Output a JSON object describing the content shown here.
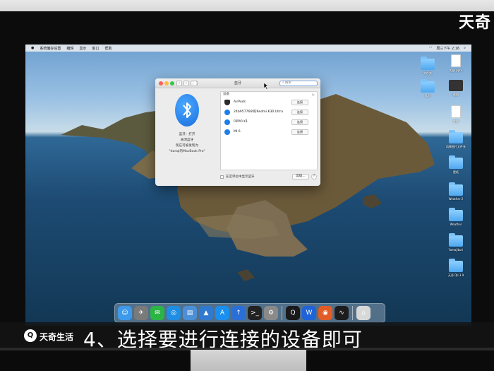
{
  "watermark": {
    "brand_top": "天奇"
  },
  "menubar": {
    "apple": "",
    "items": [
      "系统偏好设置",
      "编辑",
      "显示",
      "窗口",
      "帮助"
    ],
    "clock": "周三下午 2:16"
  },
  "bluetooth_window": {
    "title": "蓝牙",
    "search_placeholder": "搜索",
    "status_line": "蓝牙：打开",
    "toggle_link": "关闭蓝牙",
    "discoverable_line": "现在可被发现为",
    "device_name_line": "\"tianqi的MacBook Pro\"",
    "devices_header": "设备",
    "devices": [
      {
        "name": "AirPods",
        "button": "连接",
        "icon": "airpods-icon"
      },
      {
        "name": "24b957766f的Redmi K30 Ultra",
        "button": "连接",
        "icon": "bluetooth-icon"
      },
      {
        "name": "OPPO K1",
        "button": "连接",
        "icon": "bluetooth-icon"
      },
      {
        "name": "MI 6",
        "button": "连接",
        "icon": "bluetooth-icon"
      }
    ],
    "show_in_menubar": "在菜单栏中显示蓝牙",
    "advanced_button": "高级...",
    "help_button": "?"
  },
  "desktop_items": [
    {
      "label": "文件夹",
      "kind": "folder"
    },
    {
      "label": "相册.pptx",
      "kind": "file"
    },
    {
      "label": "素材",
      "kind": "folder"
    },
    {
      "label": "截图",
      "kind": "dark"
    },
    {
      "label": "文档",
      "kind": "file"
    },
    {
      "label": "风景图片文件夹",
      "kind": "folder"
    },
    {
      "label": "壁纸",
      "kind": "folder"
    },
    {
      "label": "Weather 2",
      "kind": "folder"
    },
    {
      "label": "Weather",
      "kind": "folder"
    },
    {
      "label": "Yamajibori",
      "kind": "folder"
    },
    {
      "label": "天奇 DJI 3.9",
      "kind": "folder"
    }
  ],
  "dock": {
    "apps": [
      {
        "name": "finder-icon",
        "glyph": "☺",
        "color": "#3d9aea"
      },
      {
        "name": "launchpad-icon",
        "glyph": "✈",
        "color": "#7a7a7a"
      },
      {
        "name": "wechat-icon",
        "glyph": "✉",
        "color": "#2bb545"
      },
      {
        "name": "safari-icon",
        "glyph": "◎",
        "color": "#1e8de3"
      },
      {
        "name": "files-icon",
        "glyph": "▤",
        "color": "#4b8fd6"
      },
      {
        "name": "keynote-icon",
        "glyph": "▲",
        "color": "#2f7ad0"
      },
      {
        "name": "appstore-icon",
        "glyph": "A",
        "color": "#1a8ff0"
      },
      {
        "name": "upload-icon",
        "glyph": "↑",
        "color": "#2a6fd6"
      },
      {
        "name": "terminal-icon",
        "glyph": ">_",
        "color": "#222"
      },
      {
        "name": "settings-icon",
        "glyph": "⚙",
        "color": "#8a8a8a"
      },
      {
        "name": "qq-icon",
        "glyph": "Q",
        "color": "#1a1a1a"
      },
      {
        "name": "wps-icon",
        "glyph": "W",
        "color": "#1f63d8"
      },
      {
        "name": "firefox-icon",
        "glyph": "◉",
        "color": "#e25c25"
      },
      {
        "name": "activity-icon",
        "glyph": "∿",
        "color": "#1d1d1d"
      },
      {
        "name": "trash-icon",
        "glyph": "⌂",
        "color": "#d8d8d8"
      }
    ]
  },
  "subtitle": {
    "logo_glyph": "Q",
    "brand": "天奇生活",
    "text": "4、选择要进行连接的设备即可"
  }
}
